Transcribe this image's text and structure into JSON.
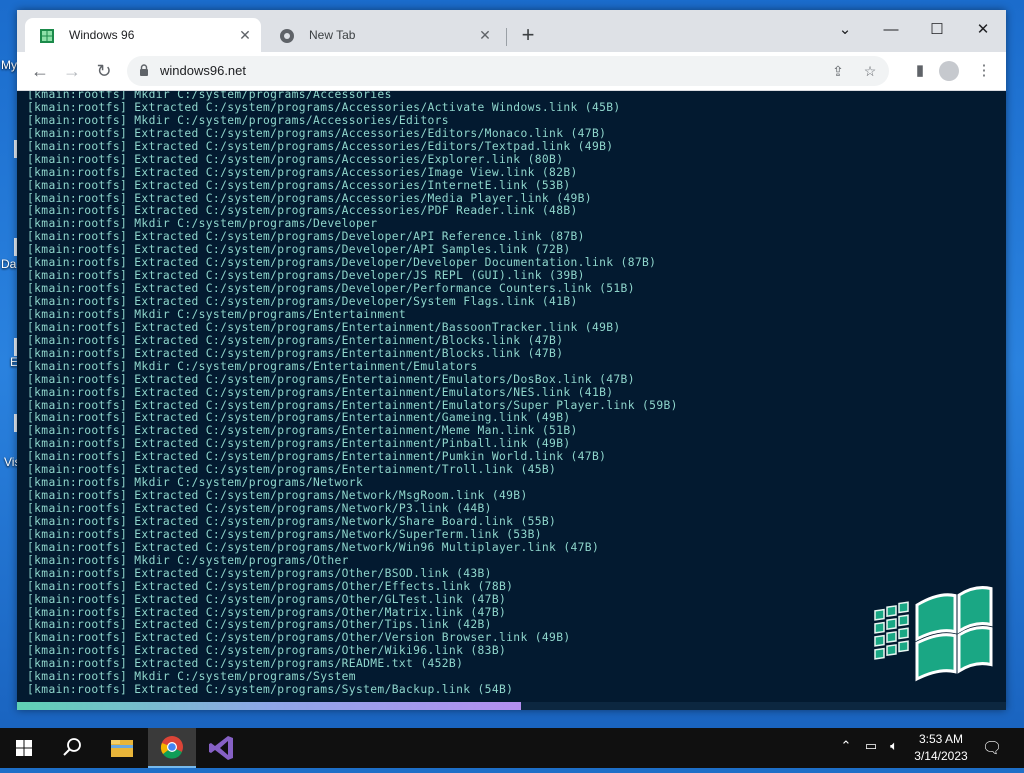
{
  "desktop": {
    "labels": [
      "My",
      "Da",
      "E",
      "Vis"
    ]
  },
  "browser": {
    "tabs": [
      {
        "title": "Windows 96",
        "active": true
      },
      {
        "title": "New Tab",
        "active": false
      }
    ],
    "url": "windows96.net",
    "window_controls": [
      "chevron-down",
      "minimize",
      "maximize",
      "close"
    ]
  },
  "terminal": {
    "colors": {
      "background": "#031a30",
      "text": "#8fd6cc"
    },
    "progress": 0.51,
    "lines": [
      "[kmain:rootfs] Mkdir C:/system/programs/Accessories",
      "[kmain:rootfs] Extracted C:/system/programs/Accessories/Activate Windows.link (45B)",
      "[kmain:rootfs] Mkdir C:/system/programs/Accessories/Editors",
      "[kmain:rootfs] Extracted C:/system/programs/Accessories/Editors/Monaco.link (47B)",
      "[kmain:rootfs] Extracted C:/system/programs/Accessories/Editors/Textpad.link (49B)",
      "[kmain:rootfs] Extracted C:/system/programs/Accessories/Explorer.link (80B)",
      "[kmain:rootfs] Extracted C:/system/programs/Accessories/Image View.link (82B)",
      "[kmain:rootfs] Extracted C:/system/programs/Accessories/InternetE.link (53B)",
      "[kmain:rootfs] Extracted C:/system/programs/Accessories/Media Player.link (49B)",
      "[kmain:rootfs] Extracted C:/system/programs/Accessories/PDF Reader.link (48B)",
      "[kmain:rootfs] Mkdir C:/system/programs/Developer",
      "[kmain:rootfs] Extracted C:/system/programs/Developer/API Reference.link (87B)",
      "[kmain:rootfs] Extracted C:/system/programs/Developer/API Samples.link (72B)",
      "[kmain:rootfs] Extracted C:/system/programs/Developer/Developer Documentation.link (87B)",
      "[kmain:rootfs] Extracted C:/system/programs/Developer/JS REPL (GUI).link (39B)",
      "[kmain:rootfs] Extracted C:/system/programs/Developer/Performance Counters.link (51B)",
      "[kmain:rootfs] Extracted C:/system/programs/Developer/System Flags.link (41B)",
      "[kmain:rootfs] Mkdir C:/system/programs/Entertainment",
      "[kmain:rootfs] Extracted C:/system/programs/Entertainment/BassoonTracker.link (49B)",
      "[kmain:rootfs] Extracted C:/system/programs/Entertainment/Blocks.link (47B)",
      "[kmain:rootfs] Extracted C:/system/programs/Entertainment/Blocks.link (47B)",
      "[kmain:rootfs] Mkdir C:/system/programs/Entertainment/Emulators",
      "[kmain:rootfs] Extracted C:/system/programs/Entertainment/Emulators/DosBox.link (47B)",
      "[kmain:rootfs] Extracted C:/system/programs/Entertainment/Emulators/NES.link (41B)",
      "[kmain:rootfs] Extracted C:/system/programs/Entertainment/Emulators/Super Player.link (59B)",
      "[kmain:rootfs] Extracted C:/system/programs/Entertainment/Gameing.link (49B)",
      "[kmain:rootfs] Extracted C:/system/programs/Entertainment/Meme Man.link (51B)",
      "[kmain:rootfs] Extracted C:/system/programs/Entertainment/Pinball.link (49B)",
      "[kmain:rootfs] Extracted C:/system/programs/Entertainment/Pumkin World.link (47B)",
      "[kmain:rootfs] Extracted C:/system/programs/Entertainment/Troll.link (45B)",
      "[kmain:rootfs] Mkdir C:/system/programs/Network",
      "[kmain:rootfs] Extracted C:/system/programs/Network/MsgRoom.link (49B)",
      "[kmain:rootfs] Extracted C:/system/programs/Network/P3.link (44B)",
      "[kmain:rootfs] Extracted C:/system/programs/Network/Share Board.link (55B)",
      "[kmain:rootfs] Extracted C:/system/programs/Network/SuperTerm.link (53B)",
      "[kmain:rootfs] Extracted C:/system/programs/Network/Win96 Multiplayer.link (47B)",
      "[kmain:rootfs] Mkdir C:/system/programs/Other",
      "[kmain:rootfs] Extracted C:/system/programs/Other/BSOD.link (43B)",
      "[kmain:rootfs] Extracted C:/system/programs/Other/Effects.link (78B)",
      "[kmain:rootfs] Extracted C:/system/programs/Other/GLTest.link (47B)",
      "[kmain:rootfs] Extracted C:/system/programs/Other/Matrix.link (47B)",
      "[kmain:rootfs] Extracted C:/system/programs/Other/Tips.link (42B)",
      "[kmain:rootfs] Extracted C:/system/programs/Other/Version Browser.link (49B)",
      "[kmain:rootfs] Extracted C:/system/programs/Other/Wiki96.link (83B)",
      "[kmain:rootfs] Extracted C:/system/programs/README.txt (452B)",
      "[kmain:rootfs] Mkdir C:/system/programs/System",
      "[kmain:rootfs] Extracted C:/system/programs/System/Backup.link (54B)"
    ]
  },
  "taskbar": {
    "pinned": [
      "start-icon",
      "search-icon",
      "file-explorer-icon",
      "chrome-icon",
      "visual-studio-icon"
    ],
    "time": "3:53 AM",
    "date": "3/14/2023"
  }
}
